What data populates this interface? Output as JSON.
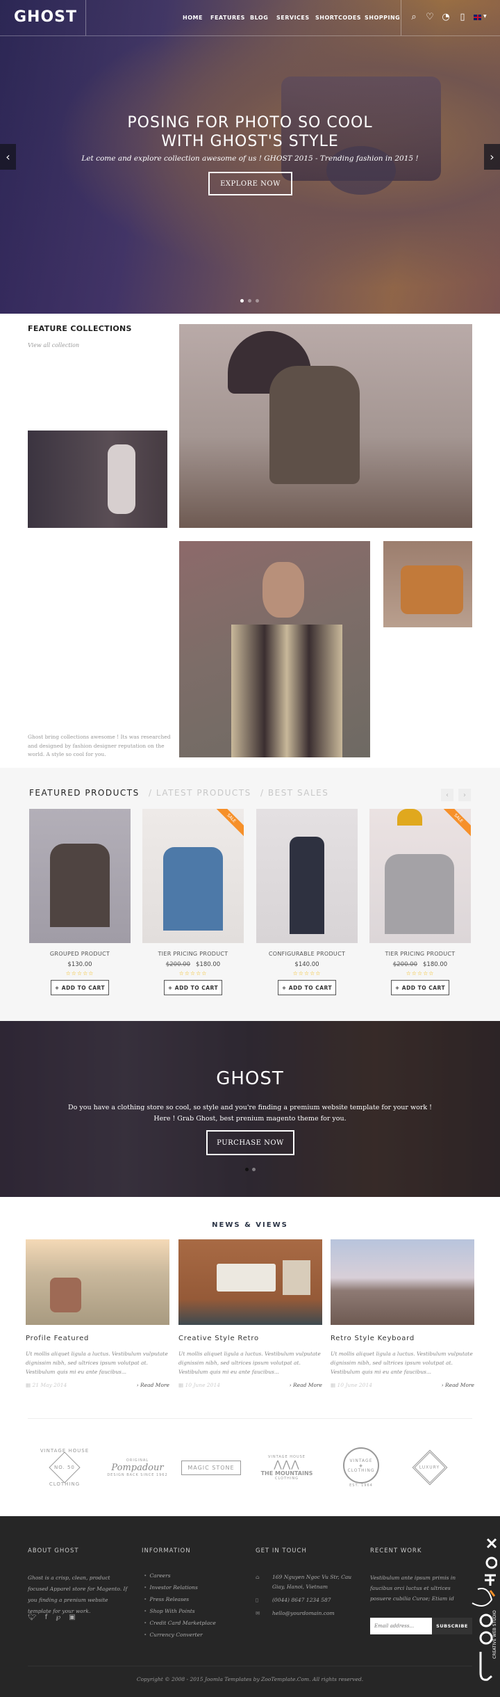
{
  "header": {
    "logo": "GHOST",
    "nav": [
      "HOME",
      "FEATURES",
      "BLOG",
      "SERVICES",
      "SHORTCODES",
      "SHOPPING"
    ],
    "icons": [
      "search-icon",
      "heart-icon",
      "compare-icon",
      "cart-icon",
      "flag-uk-icon"
    ]
  },
  "hero": {
    "title_line1": "POSING FOR PHOTO SO COOL",
    "title_line2": "WITH GHOST'S STYLE",
    "subtitle": "Let come and explore collection awesome of us ! GHOST 2015 - Trending fashion in 2015 !",
    "button": "EXPLORE NOW",
    "prev": "‹",
    "next": "›",
    "slides": 3,
    "active_slide": 1
  },
  "feature": {
    "title": "FEATURE COLLECTIONS",
    "link": "View all collection",
    "text": "Ghost bring collections awesome ! Its was researched and designed by fashion designer reputation on the world. A style so cool for you."
  },
  "products": {
    "tabs": [
      "FEATURED PRODUCTS",
      "/ LATEST PRODUCTS",
      "/ BEST SALES"
    ],
    "active_tab": 0,
    "prev": "‹",
    "next": "›",
    "sale_label": "SALE",
    "add_to_cart": "+ ADD TO CART",
    "stars": "☆☆☆☆☆",
    "items": [
      {
        "name": "GROUPED PRODUCT",
        "old_price": "",
        "price": "$130.00",
        "sale": false
      },
      {
        "name": "TIER PRICING PRODUCT",
        "old_price": "$200.00",
        "price": "$180.00",
        "sale": true
      },
      {
        "name": "CONFIGURABLE PRODUCT",
        "old_price": "",
        "price": "$140.00",
        "sale": false
      },
      {
        "name": "TIER PRICING PRODUCT",
        "old_price": "$200.00",
        "price": "$180.00",
        "sale": true
      }
    ],
    "colors": {
      "sale": "#f6902a",
      "stars": "#f2b705"
    }
  },
  "banner": {
    "title": "GHOST",
    "line1": "Do you have a clothing store so cool, so style and you're finding a premium website template for your work !",
    "line2": "Here ! Grab Ghost, best prenium magento theme for you.",
    "button": "PURCHASE NOW",
    "slides": 2,
    "active_slide": 1
  },
  "news": {
    "title": "NEWS & VIEWS",
    "read_more": "› Read More",
    "items": [
      {
        "title": "Profile Featured",
        "text": "Ut mollis aliquet ligula a luctus. Vestibulum vulputate dignissim nibh, sed ultrices ipsum volutpat at. Vestibulum quis mi eu ante faucibus...",
        "date": "21 May 2014"
      },
      {
        "title": "Creative Style Retro",
        "text": "Ut mollis aliquet ligula a luctus. Vestibulum vulputate dignissim nibh, sed ultrices ipsum volutpat at. Vestibulum quis mi eu ante faucibus...",
        "date": "10 June 2014"
      },
      {
        "title": "Retro Style Keyboard",
        "text": "Ut mollis aliquet ligula a luctus. Vestibulum vulputate dignissim nibh, sed ultrices ipsum volutpat at. Vestibulum quis mi eu ante faucibus...",
        "date": "10 June 2014"
      }
    ]
  },
  "brands": [
    {
      "top": "VINTAGE HOUSE",
      "main": "NO. 50",
      "bottom": "CLOTHING"
    },
    {
      "top": "ORIGINAL",
      "main": "Pompadour",
      "bottom": "DESIGN BACK SINCE 1962"
    },
    {
      "top": "",
      "main": "MAGIC STONE",
      "bottom": ""
    },
    {
      "top": "VINTAGE HOUSE",
      "main": "THE MOUNTAINS",
      "bottom": "CLOTHING"
    },
    {
      "top": "EST. 1964",
      "main": "VINTAGE",
      "bottom": "CLOTHING"
    },
    {
      "top": "",
      "main": "LUXURY",
      "bottom": ""
    }
  ],
  "footer": {
    "about": {
      "title": "ABOUT GHOST",
      "text": "Ghost is a crisp, clean, product focused Apparel store for Magento. If you finding a prenium website template for your work.",
      "social": [
        "twitter-icon",
        "facebook-icon",
        "pinterest-icon",
        "instagram-icon"
      ]
    },
    "info": {
      "title": "INFORMATION",
      "links": [
        "Careers",
        "Investor Relations",
        "Press Releases",
        "Shop With Points",
        "Credit Card Marketplace",
        "Currency Converter"
      ]
    },
    "contact": {
      "title": "GET IN TOUCH",
      "address": "169 Nguyen Ngoc Vu Str, Cau Giay, Hanoi, Vietnam",
      "phone": "(0044) 8647 1234 587",
      "email": "hello@yourdomain.com"
    },
    "recent": {
      "title": "RECENT WORK",
      "text": "Vestibulum ante ipsum primis in faucibus orci luctus et ultrices posuere cubilia Curae; Etiam id enim egestas, congue est id",
      "email_placeholder": "Email address...",
      "subscribe": "SUBSCRIBE"
    },
    "copyright": "Copyright © 2008 - 2015 Joomla Templates by ZooTemplate.Com. All rights reserved.",
    "watermark": "JoomFox CREATIVE WEB STUDIO"
  }
}
